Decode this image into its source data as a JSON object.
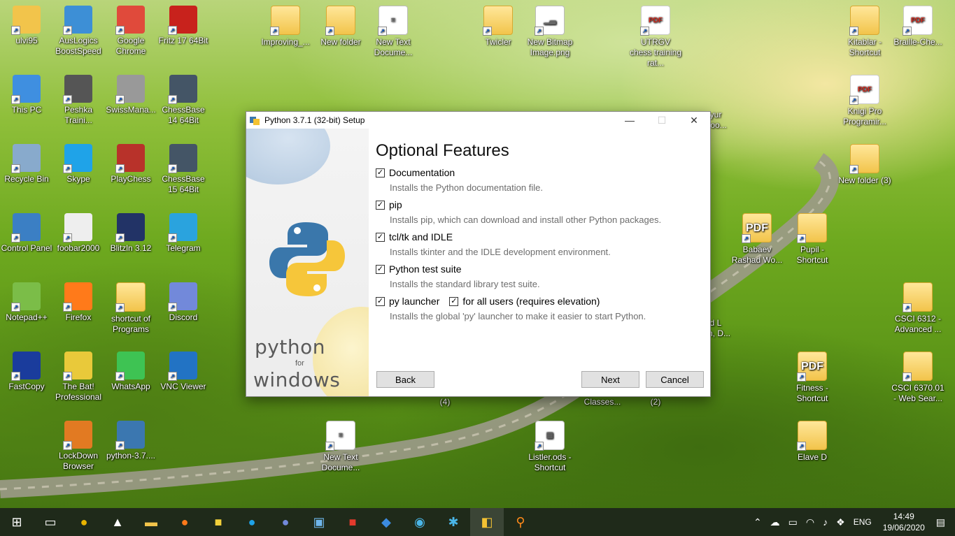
{
  "desktop": {
    "icons": [
      {
        "label": "ulvi95",
        "kind": "user-folder-icon"
      },
      {
        "label": "AusLogics BoostSpeed",
        "kind": "auslogics-icon"
      },
      {
        "label": "Google Chrome",
        "kind": "chrome-icon"
      },
      {
        "label": "Fritz 17 64Bit",
        "kind": "fritz-icon"
      },
      {
        "label": "Improving_...",
        "kind": "folder-icon"
      },
      {
        "label": "New folder",
        "kind": "folder-icon"
      },
      {
        "label": "New Text Docume...",
        "kind": "text-document-icon"
      },
      {
        "label": "Twicler",
        "kind": "folder-icon"
      },
      {
        "label": "New Bitmap Image.png",
        "kind": "image-icon"
      },
      {
        "label": "UTRGV chess training rat...",
        "kind": "pdf-icon"
      },
      {
        "label": "Kitablar - Shortcut",
        "kind": "folder-icon"
      },
      {
        "label": "Braille-Che...",
        "kind": "pdf-icon"
      },
      {
        "label": "This PC",
        "kind": "computer-icon"
      },
      {
        "label": "Peshka Traini...",
        "kind": "chess-pawn-icon"
      },
      {
        "label": "SwissMana...",
        "kind": "swissmanager-icon"
      },
      {
        "label": "ChessBase 14 64Bit",
        "kind": "chessbase-icon"
      },
      {
        "label": "Knigi Pro Programir...",
        "kind": "pdf-icon"
      },
      {
        "label": "Recycle Bin",
        "kind": "recycle-bin-icon"
      },
      {
        "label": "Skype",
        "kind": "skype-icon"
      },
      {
        "label": "PlayChess",
        "kind": "playchess-icon"
      },
      {
        "label": "ChessBase 15 64Bit",
        "kind": "chessbase-icon"
      },
      {
        "label": "New folder (3)",
        "kind": "folder-icon"
      },
      {
        "label": "Control Panel",
        "kind": "control-panel-icon"
      },
      {
        "label": "foobar2000",
        "kind": "foobar-icon"
      },
      {
        "label": "Blitzln 3.12",
        "kind": "blitzin-icon"
      },
      {
        "label": "Telegram",
        "kind": "telegram-icon"
      },
      {
        "label": "Babaev Rashad Wo...",
        "kind": "pdf-folder-icon"
      },
      {
        "label": "Pupil - Shortcut",
        "kind": "folder-icon"
      },
      {
        "label": "Notepad++",
        "kind": "notepad-plus-icon"
      },
      {
        "label": "Firefox",
        "kind": "firefox-icon"
      },
      {
        "label": "shortcut of Programs",
        "kind": "folder-icon"
      },
      {
        "label": "Discord",
        "kind": "discord-icon"
      },
      {
        "label": "CSCI 6312 - Advanced ...",
        "kind": "folder-icon"
      },
      {
        "label": "FastCopy",
        "kind": "fastcopy-icon"
      },
      {
        "label": "The Bat! Professional",
        "kind": "thebat-icon"
      },
      {
        "label": "WhatsApp",
        "kind": "whatsapp-icon"
      },
      {
        "label": "VNC Viewer",
        "kind": "vnc-icon"
      },
      {
        "label": "Fitness - Shortcut",
        "kind": "pdf-folder-icon"
      },
      {
        "label": "CSCI 6370.01 - Web Sear...",
        "kind": "folder-icon"
      },
      {
        "label": "LockDown Browser",
        "kind": "lockdown-icon"
      },
      {
        "label": "python-3.7....",
        "kind": "python-installer-icon"
      },
      {
        "label": "New Text Docume...",
        "kind": "text-document-icon"
      },
      {
        "label": "Listler.ods - Shortcut",
        "kind": "spreadsheet-icon"
      },
      {
        "label": "Elave D",
        "kind": "folder-icon"
      }
    ],
    "partial_labels": [
      "(4)",
      "Classes...",
      "(2)",
      "d L",
      "n, D...",
      "yur",
      "Boo..."
    ]
  },
  "dialog": {
    "title": "Python 3.7.1 (32-bit) Setup",
    "heading": "Optional Features",
    "watermark": {
      "top": "python",
      "mid": "for",
      "bottom": "windows"
    },
    "options": [
      {
        "label": "Documentation",
        "checked": true,
        "desc": "Installs the Python documentation file."
      },
      {
        "label": "pip",
        "checked": true,
        "desc": "Installs pip, which can download and install other Python packages."
      },
      {
        "label": "tcl/tk and IDLE",
        "checked": true,
        "desc": "Installs tkinter and the IDLE development environment."
      },
      {
        "label": "Python test suite",
        "checked": true,
        "desc": "Installs the standard library test suite."
      },
      {
        "label": "py launcher",
        "checked": true,
        "desc": "Installs the global 'py' launcher to make it easier to start Python."
      }
    ],
    "extra_option": {
      "label": "for all users (requires elevation)",
      "checked": true
    },
    "buttons": {
      "back": "Back",
      "next": "Next",
      "cancel": "Cancel"
    }
  },
  "taskbar": {
    "items": [
      "start-icon",
      "task-view-icon",
      "chrome-icon",
      "foobar-icon",
      "file-explorer-icon",
      "firefox-icon",
      "thebat-icon",
      "skype-icon",
      "discord-icon",
      "control-panel-icon",
      "acrobat-icon",
      "app-icon",
      "auslogics-icon",
      "network-icon",
      "python-installer-icon",
      "search-app-icon"
    ],
    "tray": {
      "language": "ENG",
      "time": "14:49",
      "date": "19/06/2020"
    }
  }
}
